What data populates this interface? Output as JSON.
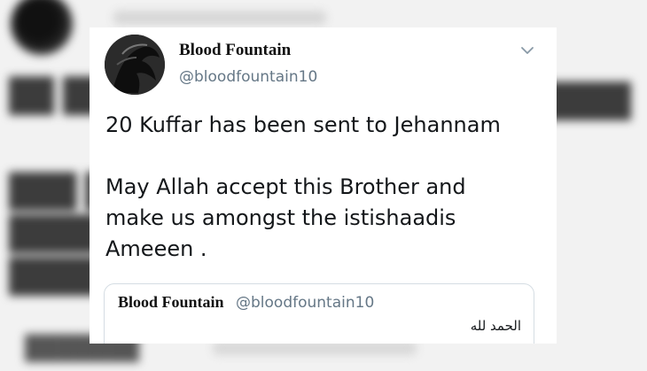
{
  "tweet": {
    "author_name": "Blood Fountain",
    "author_handle": "@bloodfountain10",
    "lines": [
      "20 Kuffar has been sent to Jehannam",
      "",
      "May Allah accept this Brother and",
      "make us amongst the istishaadis",
      "Ameeen ."
    ],
    "menu_icon": "chevron-down-icon"
  },
  "quoted_tweet": {
    "author_name": "Blood Fountain",
    "author_handle": "@bloodfountain10",
    "text": "الحمد لله"
  }
}
